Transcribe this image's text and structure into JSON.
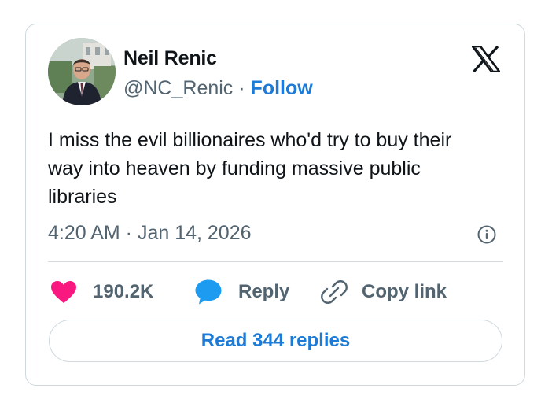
{
  "author": {
    "name": "Neil Renic",
    "handle": "@NC_Renic",
    "separator": "·",
    "follow_label": "Follow"
  },
  "tweet": {
    "text": "I miss the evil billionaires who'd try to buy their\nway into heaven by funding massive public\nlibraries",
    "timestamp": "4:20 AM · Jan 14, 2026"
  },
  "actions": {
    "like_count": "190.2K",
    "reply_label": "Reply",
    "copy_link_label": "Copy link"
  },
  "read_replies_label": "Read 344 replies",
  "icons": {
    "platform_logo": "x-logo",
    "info": "info-icon",
    "like": "heart-icon",
    "reply": "speech-bubble-icon",
    "copy_link": "link-icon"
  },
  "colors": {
    "link_blue": "#1d7bd7",
    "heart_pink": "#f91880",
    "reply_blue": "#1d9bf0",
    "secondary_text": "#536471",
    "border": "#cfd9de"
  }
}
